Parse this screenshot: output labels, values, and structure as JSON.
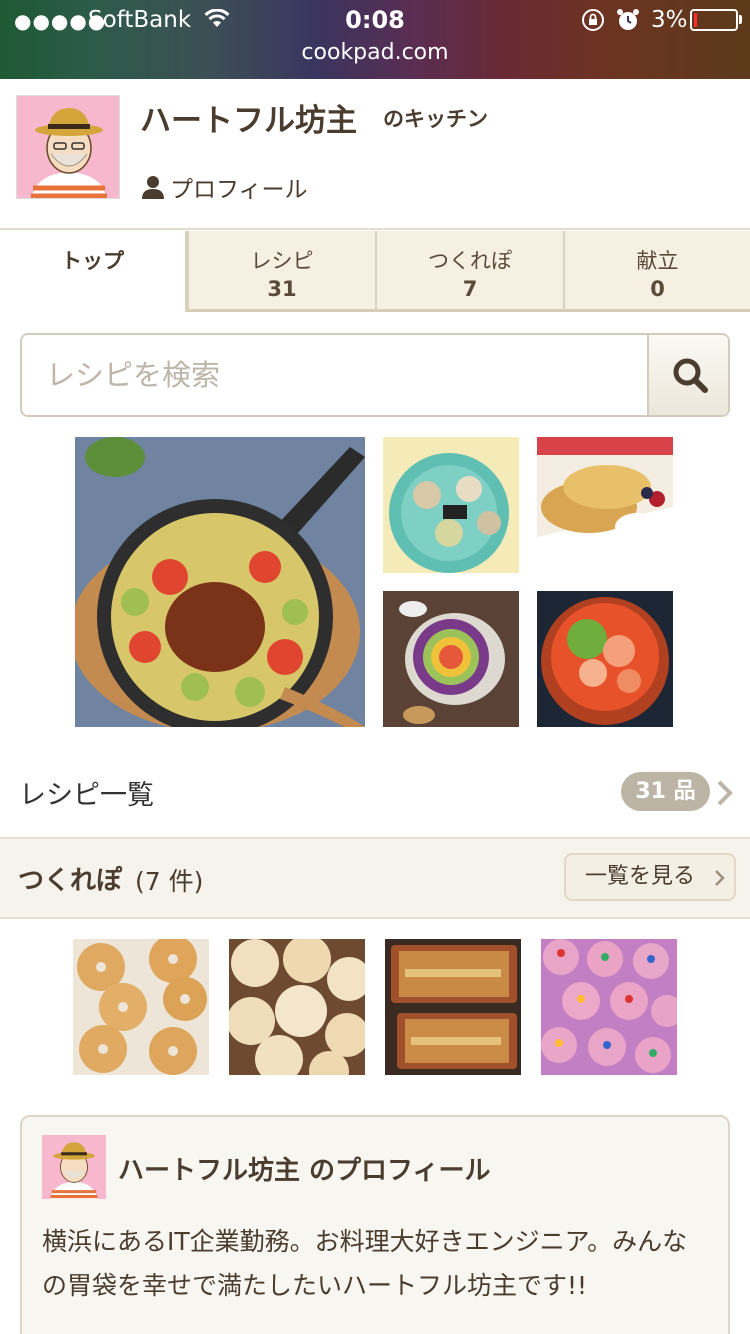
{
  "status_bar": {
    "signal": "●●●●●",
    "carrier": "SoftBank",
    "time": "0:08",
    "battery_text": "3%",
    "battery_level_percent": 3,
    "url": "cookpad.com"
  },
  "profile": {
    "kitchen_name": "ハートフル坊主",
    "kitchen_suffix": "のキッチン",
    "profile_link": "プロフィール"
  },
  "tabs": [
    {
      "label": "トップ",
      "count": ""
    },
    {
      "label": "レシピ",
      "count": "31"
    },
    {
      "label": "つくれぽ",
      "count": "7"
    },
    {
      "label": "献立",
      "count": "0"
    }
  ],
  "search": {
    "placeholder": "レシピを検索",
    "value": ""
  },
  "recipes": {
    "list_label": "レシピ一覧",
    "count": "31 品"
  },
  "tsukurepo": {
    "title": "つくれぽ",
    "count": "(7 件)",
    "more_label": "一覧を見る"
  },
  "profile_card": {
    "title": "ハートフル坊主 のプロフィール",
    "bio": "横浜にあるIT企業勤務。お料理大好きエンジニア。みんなの胃袋を幸せで満たしたいハートフル坊主です!!"
  },
  "colors": {
    "accent_brown": "#4a3c2e",
    "tab_bg": "#f5f0e1",
    "badge_gray": "#bcb5a6",
    "battery_red": "#ff2d2d"
  }
}
